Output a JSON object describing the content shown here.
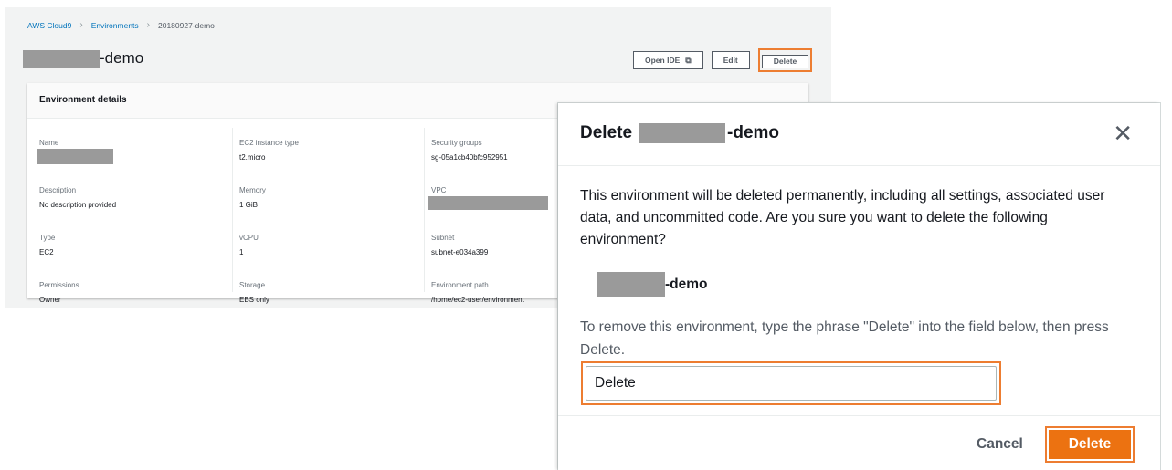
{
  "breadcrumb": {
    "items": [
      "AWS Cloud9",
      "Environments",
      "20180927-demo"
    ]
  },
  "page": {
    "title_suffix": "-demo",
    "actions": {
      "open_ide": "Open IDE",
      "edit": "Edit",
      "delete": "Delete"
    }
  },
  "details": {
    "heading": "Environment details",
    "col1": [
      {
        "label": "Name",
        "value": ""
      },
      {
        "label": "Description",
        "value": "No description provided"
      },
      {
        "label": "Type",
        "value": "EC2"
      },
      {
        "label": "Permissions",
        "value": "Owner"
      }
    ],
    "col2": [
      {
        "label": "EC2 instance type",
        "value": "t2.micro"
      },
      {
        "label": "Memory",
        "value": "1 GiB"
      },
      {
        "label": "vCPU",
        "value": "1"
      },
      {
        "label": "Storage",
        "value": "EBS only"
      }
    ],
    "col3": [
      {
        "label": "Security groups",
        "value": "sg-05a1cb40bfc952951"
      },
      {
        "label": "VPC",
        "value": ""
      },
      {
        "label": "Subnet",
        "value": "subnet-e034a399"
      },
      {
        "label": "Environment path",
        "value": "/home/ec2-user/environment"
      }
    ]
  },
  "modal": {
    "title_prefix": "Delete",
    "title_suffix": "-demo",
    "message": "This environment will be deleted permanently, including all settings, associated user data, and uncommitted code. Are you sure you want to delete the following environment?",
    "env_suffix": "-demo",
    "instruction": "To remove this environment, type the phrase \"Delete\" into the field below, then press Delete.",
    "input_value": "Delete",
    "cancel_label": "Cancel",
    "confirm_label": "Delete",
    "close_glyph": "✕"
  },
  "colors": {
    "highlight": "#ed7d31",
    "primary_button": "#ec7211",
    "link": "#0073bb"
  },
  "icons": {
    "external_link": "⧉",
    "chevron": "›"
  }
}
